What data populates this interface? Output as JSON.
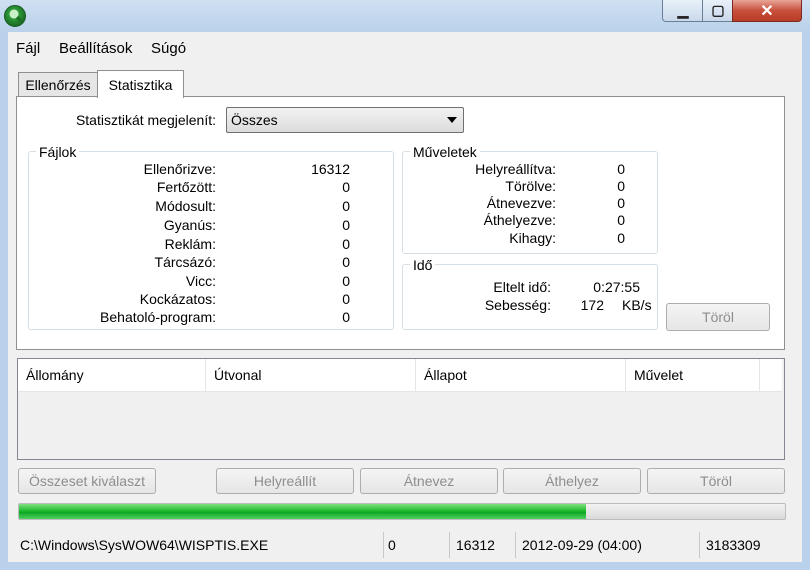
{
  "menu": {
    "file": "Fájl",
    "settings": "Beállítások",
    "help": "Súgó"
  },
  "tabs": [
    {
      "label": "Ellenőrzés"
    },
    {
      "label": "Statisztika"
    }
  ],
  "stats": {
    "display_label": "Statisztikát megjelenít:",
    "display_value": "Összes",
    "files": {
      "title": "Fájlok",
      "rows": [
        {
          "label": "Ellenőrizve:",
          "value": "16312"
        },
        {
          "label": "Fertőzött:",
          "value": "0"
        },
        {
          "label": "Módosult:",
          "value": "0"
        },
        {
          "label": "Gyanús:",
          "value": "0"
        },
        {
          "label": "Reklám:",
          "value": "0"
        },
        {
          "label": "Tárcsázó:",
          "value": "0"
        },
        {
          "label": "Vicc:",
          "value": "0"
        },
        {
          "label": "Kockázatos:",
          "value": "0"
        },
        {
          "label": "Behatoló-program:",
          "value": "0"
        }
      ]
    },
    "operations": {
      "title": "Műveletek",
      "rows": [
        {
          "label": "Helyreállítva:",
          "value": "0"
        },
        {
          "label": "Törölve:",
          "value": "0"
        },
        {
          "label": "Átnevezve:",
          "value": "0"
        },
        {
          "label": "Áthelyezve:",
          "value": "0"
        },
        {
          "label": "Kihagy:",
          "value": "0"
        }
      ]
    },
    "time": {
      "title": "Idő",
      "elapsed_label": "Eltelt idő:",
      "elapsed_value": "0:27:55",
      "speed_label": "Sebesség:",
      "speed_value": "172",
      "speed_unit": "KB/s"
    },
    "clear_button": "Töröl"
  },
  "list": {
    "columns": [
      "Állomány",
      "Útvonal",
      "Állapot",
      "Művelet"
    ]
  },
  "actions": {
    "select_all": "Összeset kiválaszt",
    "restore": "Helyreállít",
    "rename": "Átnevez",
    "move": "Áthelyez",
    "delete": "Töröl"
  },
  "progress": {
    "fraction": 0.74,
    "color": "#1fbc2f"
  },
  "statusbar": {
    "path": "C:\\Windows\\SysWOW64\\WISPTIS.EXE",
    "count1": "0",
    "count2": "16312",
    "date": "2012-09-29 (04:00)",
    "size": "3183309"
  },
  "window": {
    "close_glyph": "✕",
    "max_glyph": "▢",
    "min_glyph": "▁"
  }
}
